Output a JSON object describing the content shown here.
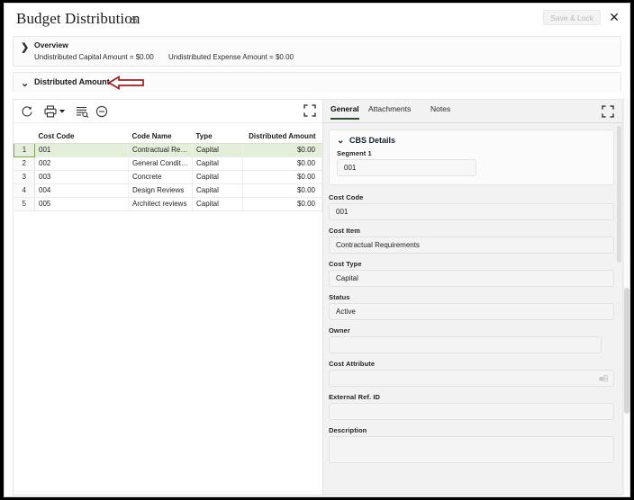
{
  "window": {
    "title": "Budget Distribution",
    "lock_icon": "lock-open-icon",
    "save_lock_label": "Save & Lock",
    "close_label": "✕"
  },
  "overview": {
    "chevron": "❯",
    "title": "Overview",
    "stats": [
      "Undistributed Capital Amount = $0.00",
      "Undistributed Expense Amount = $0.00"
    ]
  },
  "distributed": {
    "chevron": "⌄",
    "title": "Distributed Amount",
    "annotation_icon": "red-left-arrow-annotation"
  },
  "toolbar": {
    "refresh_icon": "refresh-icon",
    "print_icon": "print-icon",
    "print_caret_icon": "chevron-down-icon",
    "filter_icon": "filter-list-search-icon",
    "collapse_icon": "minus-circle-icon",
    "expand_icon": "expand-fullscreen-icon"
  },
  "table": {
    "columns": [
      "",
      "Cost Code",
      "Code Name",
      "Type",
      "Distributed Amount"
    ],
    "rows": [
      {
        "num": "1",
        "cost_code": "001",
        "code_name": "Contractual Requi...",
        "type": "Capital",
        "amount": "$0.00",
        "selected": true
      },
      {
        "num": "2",
        "cost_code": "002",
        "code_name": "General Conditions",
        "type": "Capital",
        "amount": "$0.00",
        "selected": false
      },
      {
        "num": "3",
        "cost_code": "003",
        "code_name": "Concrete",
        "type": "Capital",
        "amount": "$0.00",
        "selected": false
      },
      {
        "num": "4",
        "cost_code": "004",
        "code_name": "Design Reviews",
        "type": "Capital",
        "amount": "$0.00",
        "selected": false
      },
      {
        "num": "5",
        "cost_code": "005",
        "code_name": "Architect reviews",
        "type": "Capital",
        "amount": "$0.00",
        "selected": false
      }
    ]
  },
  "detail_panel": {
    "tabs": [
      {
        "label": "General",
        "active": true
      },
      {
        "label": "Attachments",
        "active": false
      },
      {
        "label": "Notes",
        "active": false
      }
    ],
    "expand_icon": "expand-fullscreen-icon",
    "cbs_section": {
      "chevron": "⌄",
      "title": "CBS Details",
      "segment_label": "Segment 1",
      "segment_value": "001"
    },
    "fields": [
      {
        "label": "Cost Code",
        "value": "001"
      },
      {
        "label": "Cost Item",
        "value": "Contractual Requirements"
      },
      {
        "label": "Cost Type",
        "value": "Capital"
      },
      {
        "label": "Status",
        "value": "Active"
      },
      {
        "label": "Owner",
        "value": ""
      },
      {
        "label": "Cost Attribute",
        "value": ""
      },
      {
        "label": "External Ref. ID",
        "value": ""
      },
      {
        "label": "Description",
        "value": ""
      }
    ],
    "attribute_picker_icon": "list-picker-icon"
  },
  "colors": {
    "selected_row": "#e4efda",
    "selected_row_border": "#86a06a",
    "active_tab_underline": "#2f4f2f",
    "annotation_red": "#a51c20",
    "panel_background": "#f2f2f2"
  }
}
